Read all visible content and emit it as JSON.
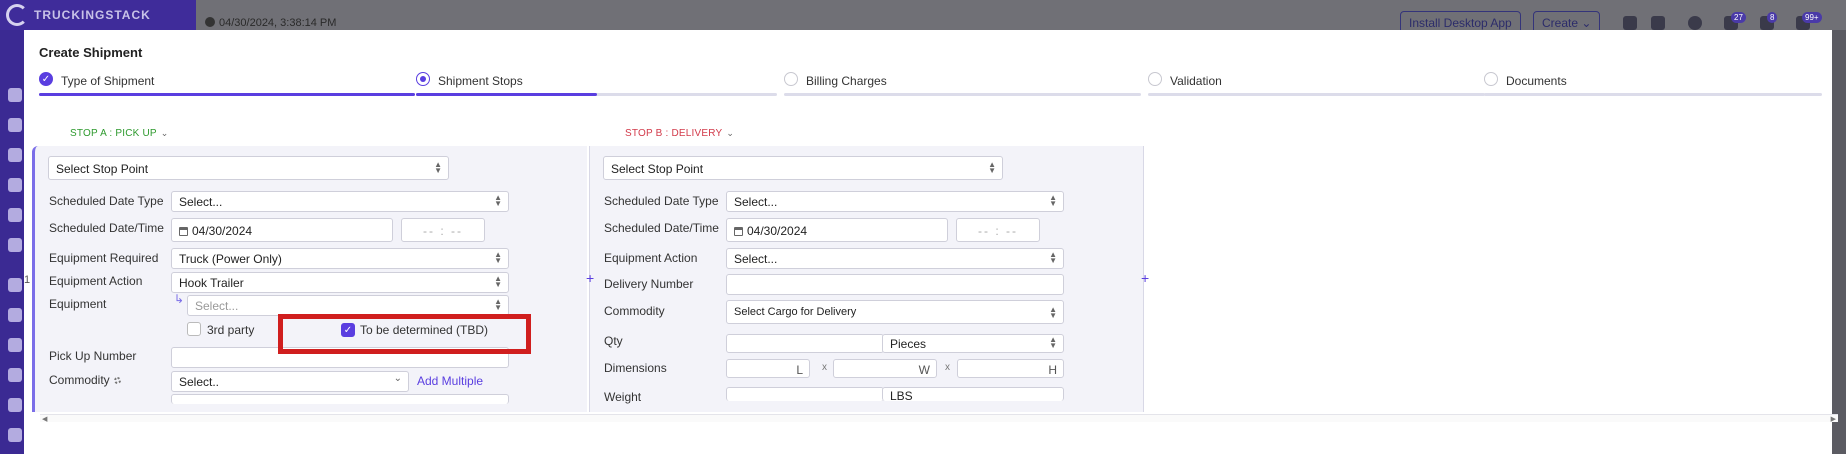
{
  "app": {
    "logo_text": "TRUCKINGSTACK",
    "timestamp": "04/30/2024, 3:38:14 PM",
    "install_button": "Install Desktop App",
    "create_button": "Create",
    "badges": [
      "27",
      "8",
      "99+"
    ]
  },
  "modal": {
    "title": "Create Shipment",
    "steps": [
      {
        "label": "Type of Shipment",
        "state": "done",
        "progress": 1.0
      },
      {
        "label": "Shipment Stops",
        "state": "current",
        "progress": 0.5
      },
      {
        "label": "Billing Charges",
        "state": "pending",
        "progress": 0
      },
      {
        "label": "Validation",
        "state": "pending",
        "progress": 0
      },
      {
        "label": "Documents",
        "state": "pending",
        "progress": 0
      }
    ]
  },
  "stop_a": {
    "tab_label": "STOP A : PICK UP",
    "stop_point": "Select Stop Point",
    "scheduled_date_type_label": "Scheduled Date Type",
    "scheduled_date_type_value": "Select...",
    "scheduled_datetime_label": "Scheduled Date/Time",
    "date_value": "04/30/2024",
    "time_placeholder": "-- : --",
    "equipment_required_label": "Equipment Required",
    "equipment_required_value": "Truck (Power Only)",
    "equipment_action_label": "Equipment Action",
    "equipment_action_value": "Hook Trailer",
    "equipment_label": "Equipment",
    "equipment_placeholder": "Select...",
    "third_party_label": "3rd party",
    "third_party_checked": false,
    "tbd_label": "To be determined (TBD)",
    "tbd_checked": true,
    "pickup_number_label": "Pick Up Number",
    "pickup_number_value": "",
    "commodity_label": "Commodity",
    "commodity_value": "Select..",
    "add_multiple_label": "Add Multiple",
    "row_marker": "1"
  },
  "stop_b": {
    "tab_label": "STOP B : DELIVERY",
    "stop_point": "Select Stop Point",
    "scheduled_date_type_label": "Scheduled Date Type",
    "scheduled_date_type_value": "Select...",
    "scheduled_datetime_label": "Scheduled Date/Time",
    "date_value": "04/30/2024",
    "time_placeholder": "-- : --",
    "equipment_action_label": "Equipment Action",
    "equipment_action_value": "Select...",
    "delivery_number_label": "Delivery Number",
    "delivery_number_value": "",
    "commodity_label": "Commodity",
    "commodity_value": "Select Cargo for Delivery",
    "qty_label": "Qty",
    "qty_value": "",
    "qty_unit": "Pieces",
    "dimensions_label": "Dimensions",
    "dim_l": "L",
    "dim_w": "W",
    "dim_h": "H",
    "dim_sep": "x",
    "weight_label": "Weight",
    "weight_unit": "LBS"
  },
  "colors": {
    "accent": "#5a3ee0",
    "pickup": "#2e9a2e",
    "delivery": "#d23a4a",
    "highlight": "#d01e1e"
  }
}
